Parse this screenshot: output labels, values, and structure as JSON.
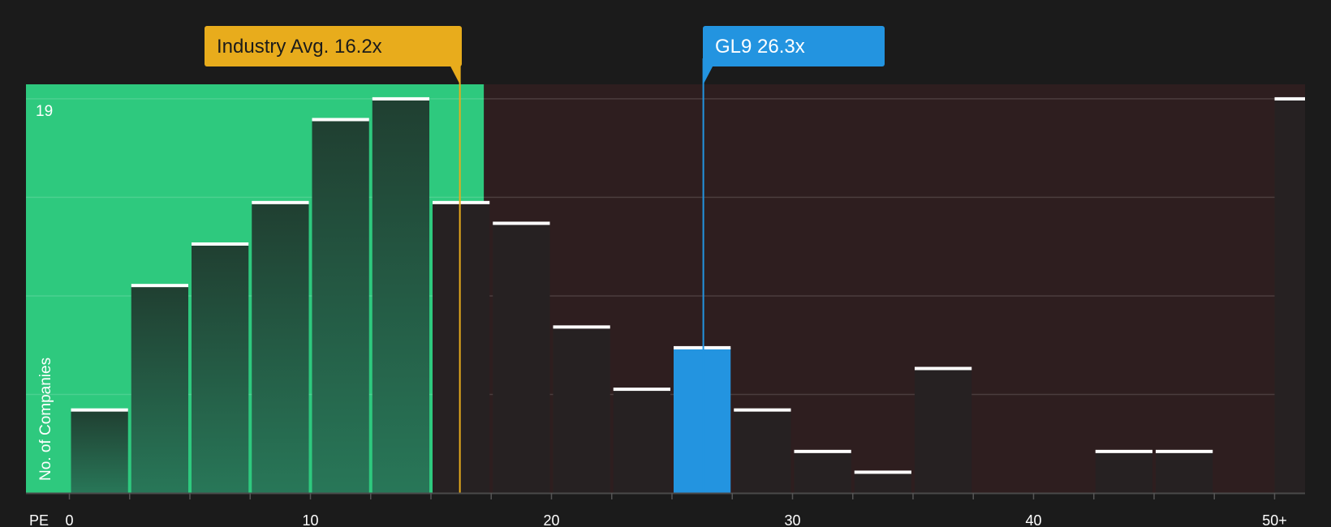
{
  "colors": {
    "background": "#1b1b1b",
    "below_avg_zone": "#2ec97e",
    "above_avg_zone": "#2e1e1f",
    "bar_in_green": "#22503a",
    "bar_dark": "#262122",
    "highlight_bar": "#2394e0",
    "industry_marker": "#e8ac1c",
    "company_marker": "#2394e0",
    "bar_cap": "#ffffff"
  },
  "chart_data": {
    "type": "bar",
    "title": "",
    "xlabel": "PE",
    "ylabel": "No. of Companies",
    "y_max_label": "19",
    "ylim": [
      0,
      19.7
    ],
    "y_gridlines": [
      4.75,
      9.5,
      14.25,
      19
    ],
    "x_ticks": [
      {
        "value": 0,
        "label": "0"
      },
      {
        "value": 10,
        "label": "10"
      },
      {
        "value": 20,
        "label": "20"
      },
      {
        "value": 30,
        "label": "30"
      },
      {
        "value": 40,
        "label": "40"
      },
      {
        "value": 50,
        "label": "50+"
      }
    ],
    "bin_width": 2.5,
    "bins": [
      {
        "start": 0,
        "count": 4
      },
      {
        "start": 2.5,
        "count": 10
      },
      {
        "start": 5,
        "count": 12
      },
      {
        "start": 7.5,
        "count": 14
      },
      {
        "start": 10,
        "count": 18
      },
      {
        "start": 12.5,
        "count": 19
      },
      {
        "start": 15,
        "count": 14
      },
      {
        "start": 17.5,
        "count": 13
      },
      {
        "start": 20,
        "count": 8
      },
      {
        "start": 22.5,
        "count": 5
      },
      {
        "start": 25,
        "count": 7,
        "highlight": true
      },
      {
        "start": 27.5,
        "count": 4
      },
      {
        "start": 30,
        "count": 2
      },
      {
        "start": 32.5,
        "count": 1
      },
      {
        "start": 35,
        "count": 6
      },
      {
        "start": 42.5,
        "count": 2
      },
      {
        "start": 45,
        "count": 2
      },
      {
        "start": 50,
        "count": 19
      }
    ],
    "industry_avg": {
      "value": 16.2,
      "label": "Industry Avg. 16.2x"
    },
    "company": {
      "value": 26.3,
      "label": "GL9 26.3x"
    }
  }
}
